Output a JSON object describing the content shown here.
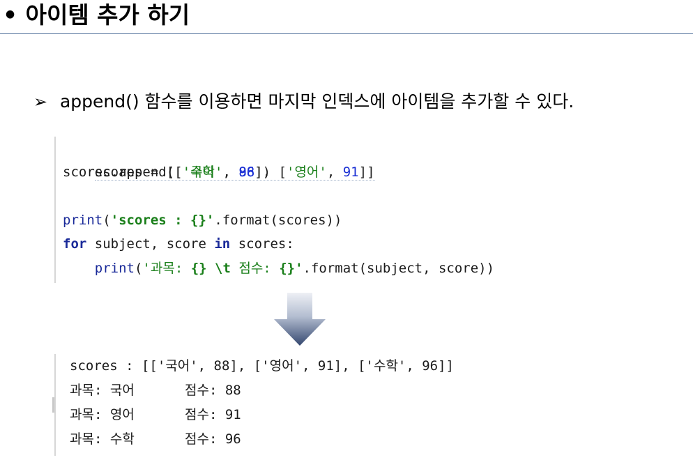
{
  "heading": {
    "bullet": "•",
    "title": "아이템 추가 하기"
  },
  "note": {
    "marker": "➢",
    "text": "append() 함수를 이용하면 마지막 인덱스에 아이템을 추가할 수 있다."
  },
  "code": {
    "line1": {
      "a": "scores = [[",
      "s1": "'국어'",
      "b": ", ",
      "n1": "88",
      "c": "], [",
      "s2": "'영어'",
      "d": ", ",
      "n2": "91",
      "e": "]]"
    },
    "line2": {
      "a": "scores.append([",
      "s1": "'수학'",
      "b": ", ",
      "n1": "96",
      "c": "])"
    },
    "line3": {
      "fn": "print",
      "a": "(",
      "s1": "'scores : {}'",
      "b": ".format(scores))"
    },
    "line4": {
      "kw1": "for",
      "a": " subject, score ",
      "kw2": "in",
      "b": " scores:"
    },
    "line5": {
      "indent": "    ",
      "fn": "print",
      "a": "(",
      "s1": "'과목: ",
      "s2": "{} \\t",
      "s3": " 점수: ",
      "s4": "{}'",
      "b": ".format(subject, score))"
    }
  },
  "output": {
    "line1": "scores : [['국어', 88], ['영어', 91], ['수학', 96]]",
    "rows": [
      {
        "subject": "과목: 국어",
        "score": "점수: 88"
      },
      {
        "subject": "과목: 영어",
        "score": "점수: 91"
      },
      {
        "subject": "과목: 수학",
        "score": "점수: 96"
      }
    ]
  },
  "colors": {
    "rule": "#4f6f9a",
    "string": "#1a7f1a",
    "number": "#1a2fd4",
    "keyword": "#1a2a99",
    "arrow_top": "#e8ebf2",
    "arrow_bottom": "#3b4f78"
  }
}
